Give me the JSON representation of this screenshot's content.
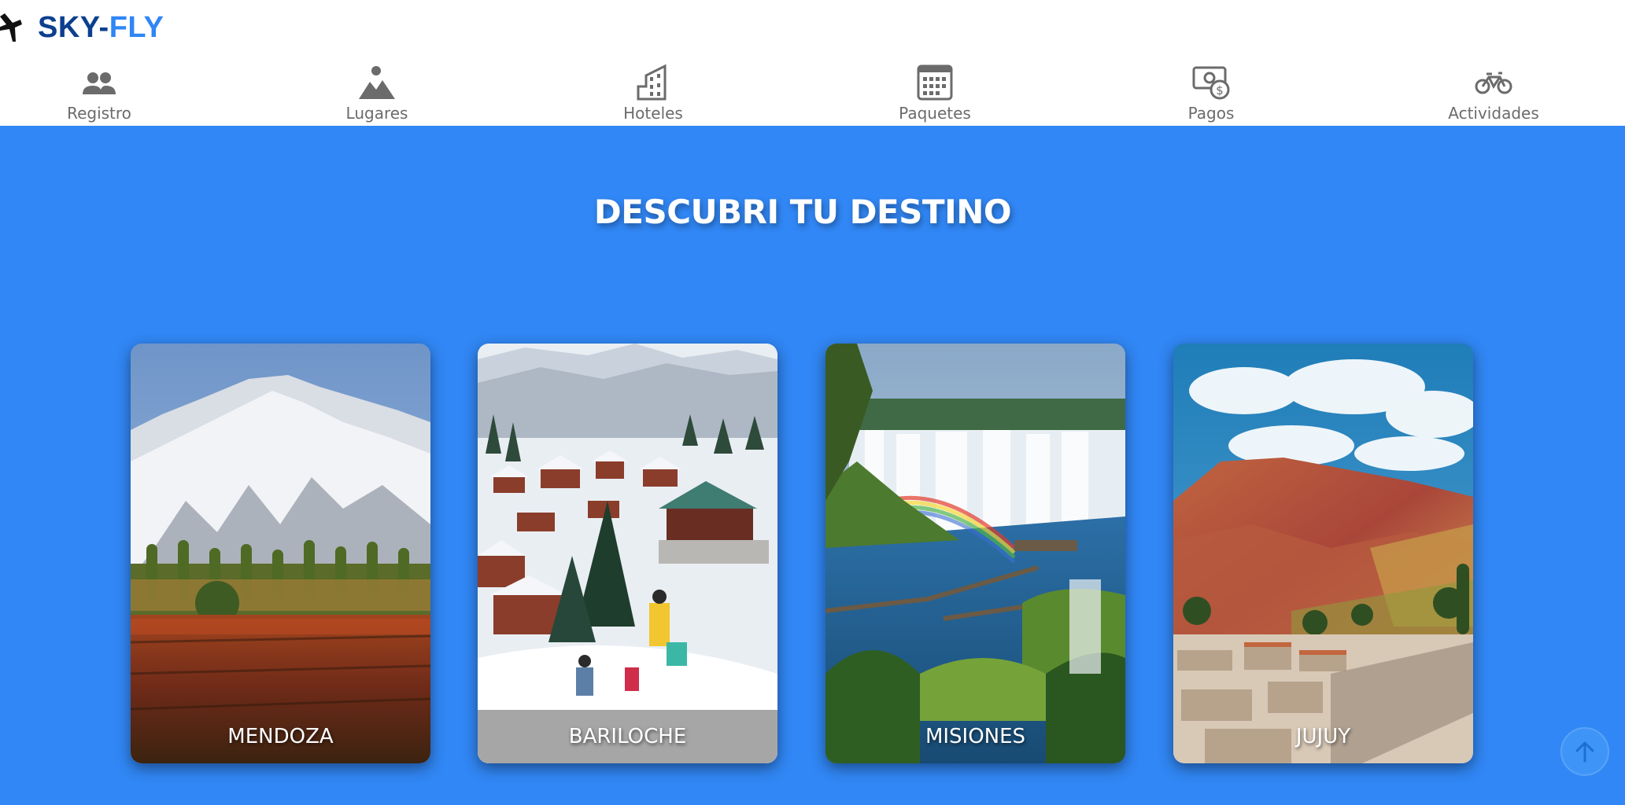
{
  "brand": {
    "name_part1": "SKY-",
    "name_part2": "FLY",
    "logo_icon": "airplane-icon"
  },
  "nav": {
    "items": [
      {
        "label": "Registro",
        "icon": "users-icon"
      },
      {
        "label": "Lugares",
        "icon": "landscape-icon"
      },
      {
        "label": "Hoteles",
        "icon": "building-icon"
      },
      {
        "label": "Paquetes",
        "icon": "calendar-icon"
      },
      {
        "label": "Pagos",
        "icon": "payment-icon"
      },
      {
        "label": "Actividades",
        "label_display": "Actividades",
        "icon": "bicycle-icon"
      }
    ]
  },
  "hero": {
    "title": "DESCUBRI TU DESTINO"
  },
  "destinations": [
    {
      "name": "MENDOZA",
      "scene": "snow-mountains-and-vineyard"
    },
    {
      "name": "BARILOCHE",
      "scene": "ski-village"
    },
    {
      "name": "MISIONES",
      "scene": "waterfalls-with-rainbow"
    },
    {
      "name": "JUJUY",
      "scene": "colorful-hills-and-town"
    }
  ],
  "scroll_top": {
    "icon": "arrow-up-icon"
  },
  "colors": {
    "accent": "#3187f5",
    "brand_dark": "#0d3f8f",
    "brand_light": "#2f86f6",
    "nav_text": "#6b6b6b"
  }
}
